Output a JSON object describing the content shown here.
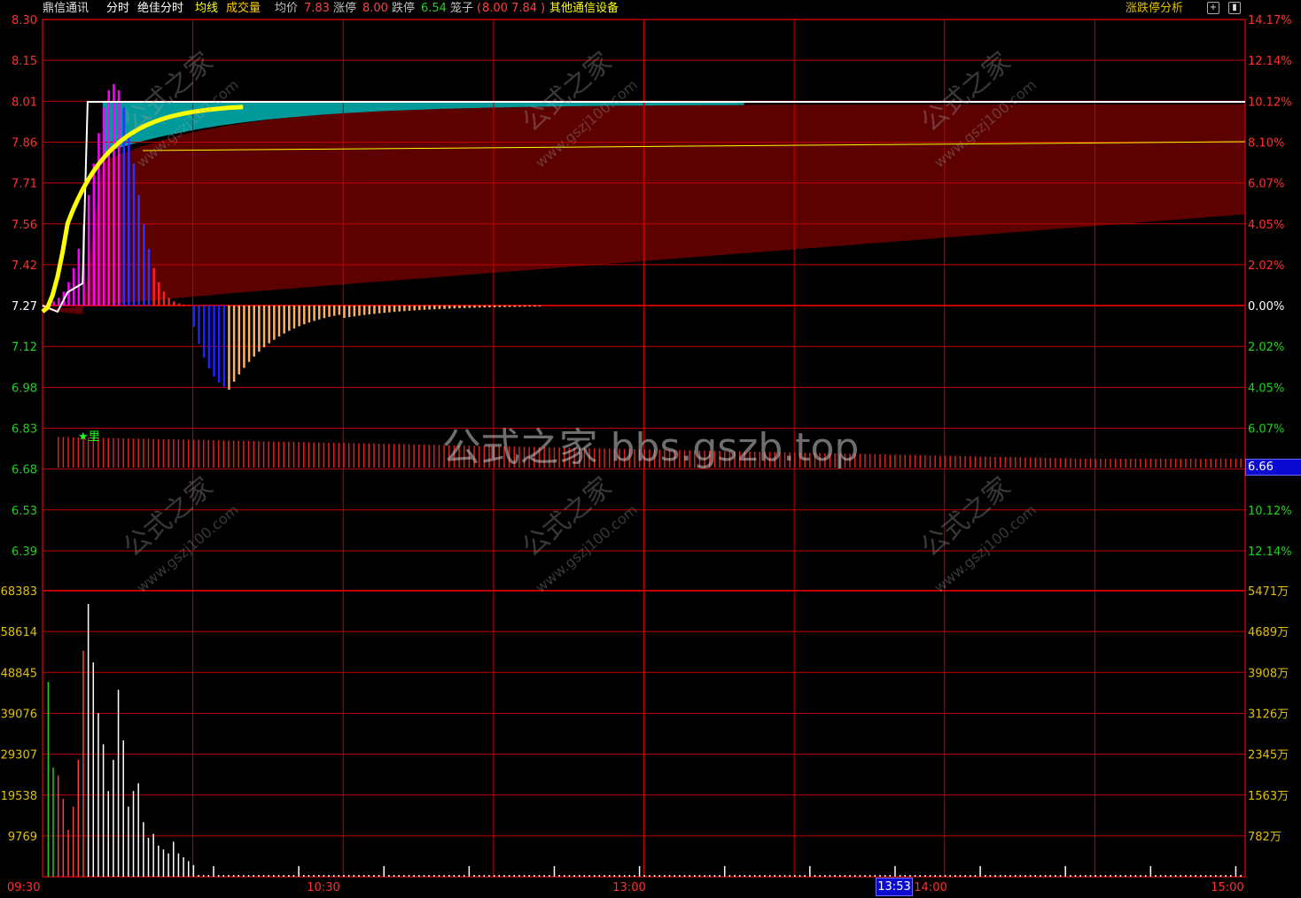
{
  "header": {
    "stock_name": "鼎信通讯",
    "mode": "分时",
    "indicator": "绝佳分时",
    "avg_line_label": "均线",
    "volume_label": "成交量",
    "avg_price_label": "均价",
    "avg_price_value": "7.83",
    "limit_up_label": "涨停",
    "limit_up_value": "8.00",
    "limit_down_label": "跌停",
    "limit_down_value": "6.54",
    "cage_label": "笼子",
    "cage_open": "(",
    "cage_values": "8.00 7.84",
    "cage_close": ")",
    "sector": "其他通信设备",
    "analysis_button": "涨跌停分析",
    "icon_1": "plus-icon",
    "icon_2": "panel-icon"
  },
  "price_axis_left": [
    "8.30",
    "8.15",
    "8.01",
    "7.86",
    "7.71",
    "7.56",
    "7.42",
    "7.27",
    "7.12",
    "6.98",
    "6.83",
    "6.68",
    "6.53",
    "6.39"
  ],
  "percent_axis_right": [
    "14.17%",
    "12.14%",
    "10.12%",
    "8.10%",
    "6.07%",
    "4.05%",
    "2.02%",
    "0.00%",
    "2.02%",
    "4.05%",
    "6.07%",
    "",
    "10.12%",
    "12.14%"
  ],
  "volume_axis_left": [
    "68383",
    "58614",
    "48845",
    "39076",
    "29307",
    "19538",
    "9769"
  ],
  "volume_axis_right": [
    "5471万",
    "4689万",
    "3908万",
    "3126万",
    "2345万",
    "1563万",
    "782万"
  ],
  "time_axis": [
    "09:30",
    "10:30",
    "13:00",
    "14:00",
    "15:00"
  ],
  "cursor": {
    "time": "13:53",
    "price": "6.66"
  },
  "marker_label": "★里",
  "watermarks": {
    "center": "公式之家 bbs.gszb.top",
    "diag_cn": "公式之家",
    "diag_url": "www.gszj100.com"
  },
  "colors": {
    "grid": "#c00000",
    "axis_up": "#ff3030",
    "axis_down": "#20d020",
    "price_line": "#ffffff",
    "avg_line": "#ffff00",
    "dark_fill": "#5c0000",
    "teal_fill": "#009a9a",
    "volume_axis": "#e0c000"
  }
}
